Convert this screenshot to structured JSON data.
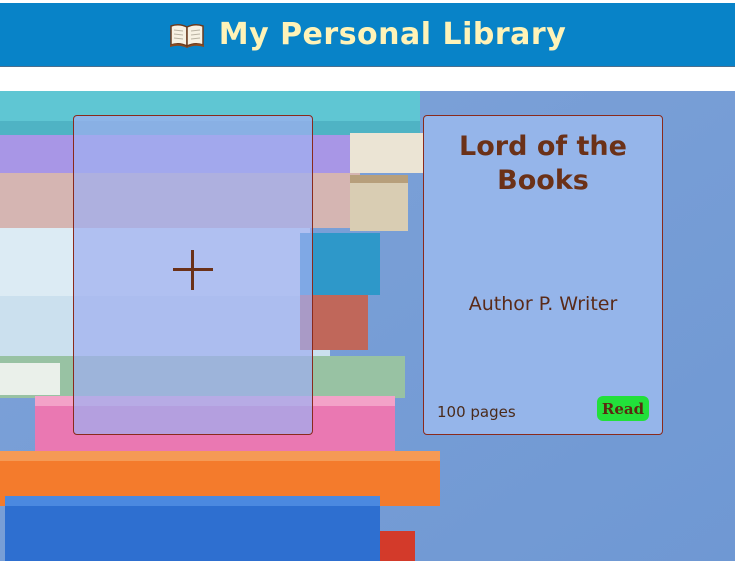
{
  "header": {
    "title": "My Personal Library",
    "icon": "open-book-icon",
    "background_color": "#0883c8",
    "title_color": "#fff3b8"
  },
  "add_card": {
    "icon": "plus-icon",
    "label": "+"
  },
  "books": [
    {
      "title": "Lord of the Books",
      "author": "Author P. Writer",
      "pages": "100 pages",
      "status": "Read",
      "status_color": "#22e03a"
    }
  ],
  "colors": {
    "card_border": "#8a2a1c",
    "card_text": "#6b3118",
    "card_background": "#95b5ea"
  }
}
